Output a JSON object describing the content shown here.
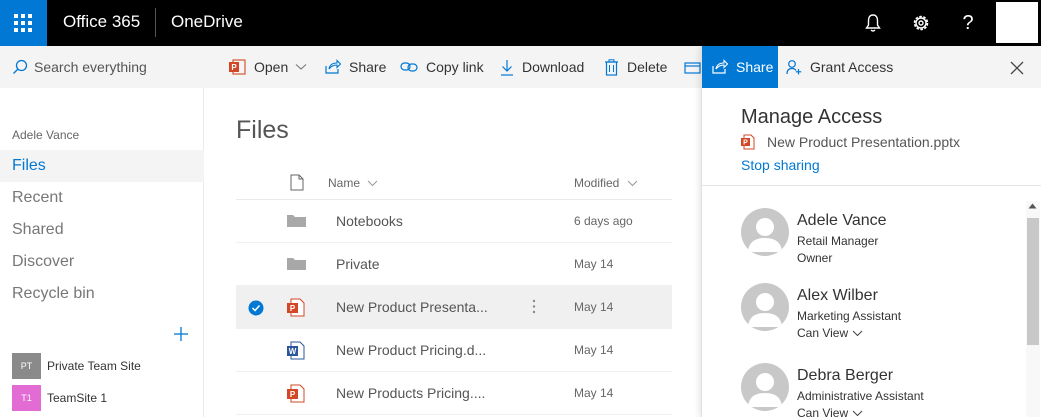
{
  "topbar": {
    "brand": "Office 365",
    "app": "OneDrive",
    "help_label": "?"
  },
  "search": {
    "placeholder": "Search everything"
  },
  "nav": {
    "user": "Adele Vance",
    "items": [
      {
        "label": "Files",
        "active": true
      },
      {
        "label": "Recent"
      },
      {
        "label": "Shared"
      },
      {
        "label": "Discover"
      },
      {
        "label": "Recycle bin"
      }
    ],
    "sites": [
      {
        "badge": "PT",
        "label": "Private Team Site",
        "color": "#8a8a8a"
      },
      {
        "badge": "T1",
        "label": "TeamSite 1",
        "color": "#e36bd4"
      }
    ]
  },
  "commands": {
    "open": "Open",
    "share": "Share",
    "copy_link": "Copy link",
    "download": "Download",
    "delete": "Delete"
  },
  "files": {
    "title": "Files",
    "col_name": "Name",
    "col_modified": "Modified",
    "rows": [
      {
        "name": "Notebooks",
        "type": "folder",
        "modified": "6 days ago",
        "selected": false
      },
      {
        "name": "Private",
        "type": "folder",
        "modified": "May 14",
        "selected": false
      },
      {
        "name": "New Product Presenta...",
        "type": "pptx",
        "modified": "May 14",
        "selected": true
      },
      {
        "name": "New Product Pricing.d...",
        "type": "docx",
        "modified": "May 14",
        "selected": false
      },
      {
        "name": "New Products Pricing....",
        "type": "pptx",
        "modified": "May 14",
        "selected": false
      }
    ]
  },
  "panel": {
    "tab_share": "Share",
    "tab_grant": "Grant Access",
    "title": "Manage Access",
    "document": "New Product Presentation.pptx",
    "stop_sharing": "Stop sharing",
    "people": [
      {
        "name": "Adele Vance",
        "role": "Retail Manager",
        "permission": "Owner",
        "dropdown": false
      },
      {
        "name": "Alex Wilber",
        "role": "Marketing Assistant",
        "permission": "Can View",
        "dropdown": true
      },
      {
        "name": "Debra Berger",
        "role": "Administrative Assistant",
        "permission": "Can View",
        "dropdown": true
      }
    ]
  },
  "colors": {
    "accent": "#0078d4",
    "topbar": "#000000",
    "ppt": "#d24726",
    "word": "#2b579a"
  }
}
